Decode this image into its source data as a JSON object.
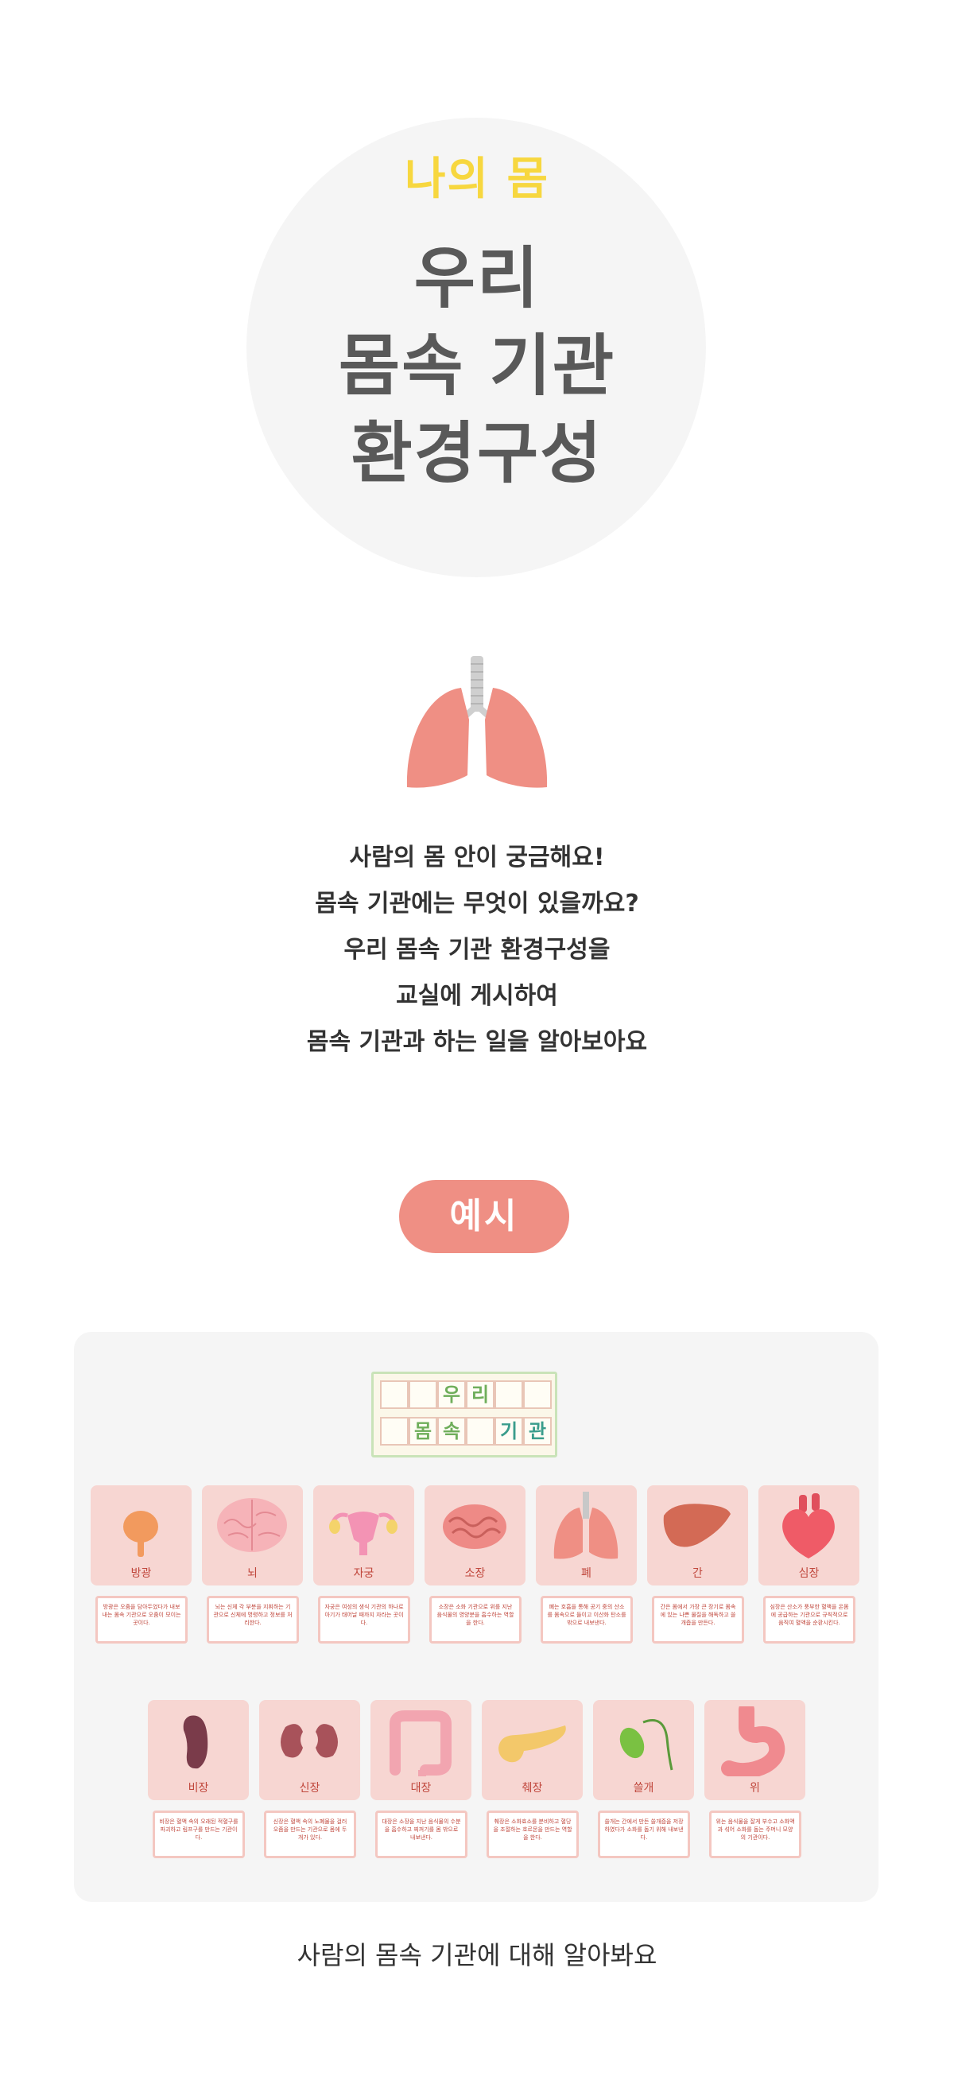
{
  "hero": {
    "subtitle": "나의 몸",
    "title_lines": [
      "우리",
      "몸속 기관",
      "환경구성"
    ]
  },
  "intro": {
    "lines": [
      "사람의 몸 안이 궁금해요!",
      "몸속 기관에는 무엇이 있을까요?",
      "우리 몸속 기관 환경구성을",
      "교실에 게시하여",
      "몸속 기관과 하는 일을 알아보아요"
    ]
  },
  "example_label": "예시",
  "banner": {
    "row1": [
      "",
      "",
      "우",
      "리",
      "",
      ""
    ],
    "row2": [
      "",
      "몸",
      "속",
      "",
      "기",
      "관"
    ]
  },
  "organs_row1": [
    {
      "label": "방광",
      "icon": "bladder-icon",
      "desc": "방광은 오줌을 담아두었다가 내보내는 몸속 기관으로 오줌이 모이는 곳이다."
    },
    {
      "label": "뇌",
      "icon": "brain-icon",
      "desc": "뇌는 신체 각 부분을 지휘하는 기관으로 신체에 명령하고 정보를 처리한다."
    },
    {
      "label": "자궁",
      "icon": "uterus-icon",
      "desc": "자궁은 여성의 생식 기관의 하나로 아기가 태어날 때까지 자라는 곳이다."
    },
    {
      "label": "소장",
      "icon": "small-intestine-icon",
      "desc": "소장은 소화 기관으로 위를 지난 음식물의 영양분을 흡수하는 역할을 한다."
    },
    {
      "label": "폐",
      "icon": "lung-icon",
      "desc": "폐는 호흡을 통해 공기 중의 산소를 몸속으로 들이고 이산화 탄소를 밖으로 내보낸다."
    },
    {
      "label": "간",
      "icon": "liver-icon",
      "desc": "간은 몸에서 가장 큰 장기로 몸속에 있는 나쁜 물질을 해독하고 쓸개즙을 만든다."
    },
    {
      "label": "심장",
      "icon": "heart-icon",
      "desc": "심장은 산소가 풍부한 혈액을 온몸에 공급하는 기관으로 규칙적으로 움직여 혈액을 순환시킨다."
    }
  ],
  "organs_row2": [
    {
      "label": "비장",
      "icon": "spleen-icon",
      "desc": "비장은 혈액 속의 오래된 적혈구를 파괴하고 림프구를 만드는 기관이다."
    },
    {
      "label": "신장",
      "icon": "kidney-icon",
      "desc": "신장은 혈액 속의 노폐물을 걸러 오줌을 만드는 기관으로 몸에 두 개가 있다."
    },
    {
      "label": "대장",
      "icon": "large-intestine-icon",
      "desc": "대장은 소장을 지난 음식물의 수분을 흡수하고 찌꺼기를 몸 밖으로 내보낸다."
    },
    {
      "label": "췌장",
      "icon": "pancreas-icon",
      "desc": "췌장은 소화효소를 분비하고 혈당을 조절하는 호르몬을 만드는 역할을 한다."
    },
    {
      "label": "쓸개",
      "icon": "gallbladder-icon",
      "desc": "쓸개는 간에서 만든 쓸개즙을 저장하였다가 소화를 돕기 위해 내보낸다."
    },
    {
      "label": "위",
      "icon": "stomach-icon",
      "desc": "위는 음식물을 잘게 부수고 소화액과 섞어 소화를 돕는 주머니 모양의 기관이다."
    }
  ],
  "caption": "사람의 몸속 기관에 대해 알아봐요",
  "colors": {
    "accent": "#ef8f84",
    "subtitle_yellow": "#f7d73f",
    "title_gray": "#595959",
    "card_pink": "#f7d6d2",
    "label_red": "#c0473c"
  }
}
